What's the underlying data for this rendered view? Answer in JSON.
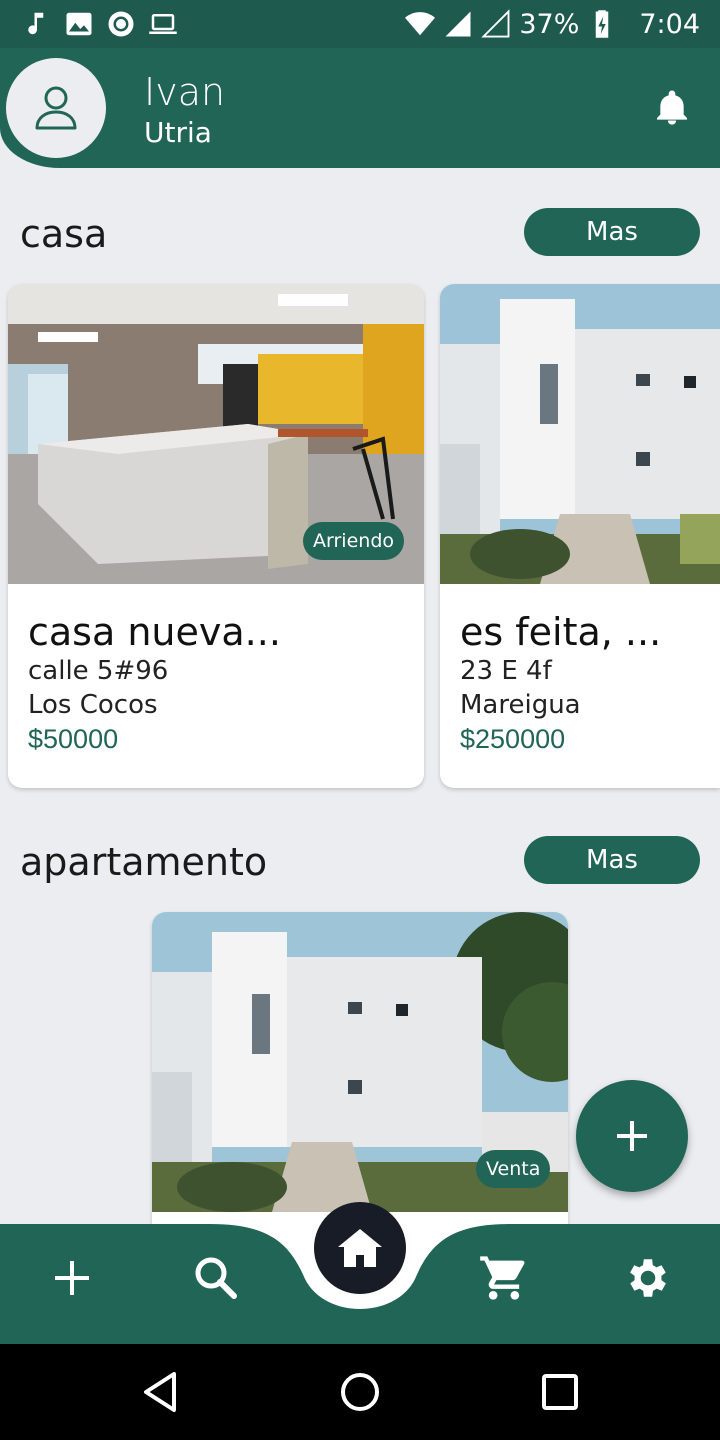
{
  "status_bar": {
    "battery": "37%",
    "time": "7:04",
    "left_icons": [
      "music-note-icon",
      "image-icon",
      "record-icon",
      "laptop-icon"
    ],
    "right_icons": [
      "wifi-icon",
      "signal-icon",
      "signal-empty-icon",
      "battery-charging-icon"
    ]
  },
  "header": {
    "first_name": "Ivan",
    "last_name": "Utria",
    "avatar_icon": "user-icon",
    "notification_icon": "bell-icon"
  },
  "sections": [
    {
      "title": "casa",
      "more_label": "Mas",
      "cards": [
        {
          "title": "casa nueva...",
          "address": "calle 5#96",
          "neighborhood": "Los Cocos",
          "price": "$50000",
          "tag": "Arriendo"
        },
        {
          "title": "es feita, ...",
          "address": "23 E 4f",
          "neighborhood": "Mareigua",
          "price": "$250000",
          "tag": ""
        }
      ]
    },
    {
      "title": "apartamento",
      "more_label": "Mas",
      "cards": [
        {
          "title": "",
          "address": "",
          "neighborhood": "",
          "price": "",
          "tag": "Venta"
        }
      ]
    }
  ],
  "fab_icon": "plus-icon",
  "bottom_nav": [
    "add-icon",
    "search-icon",
    "home-icon",
    "cart-icon",
    "settings-icon"
  ],
  "system_nav": [
    "back-icon",
    "home-circle-icon",
    "recents-icon"
  ],
  "colors": {
    "primary": "#216556",
    "background": "#ECEDF1",
    "home_button": "#171C26"
  }
}
